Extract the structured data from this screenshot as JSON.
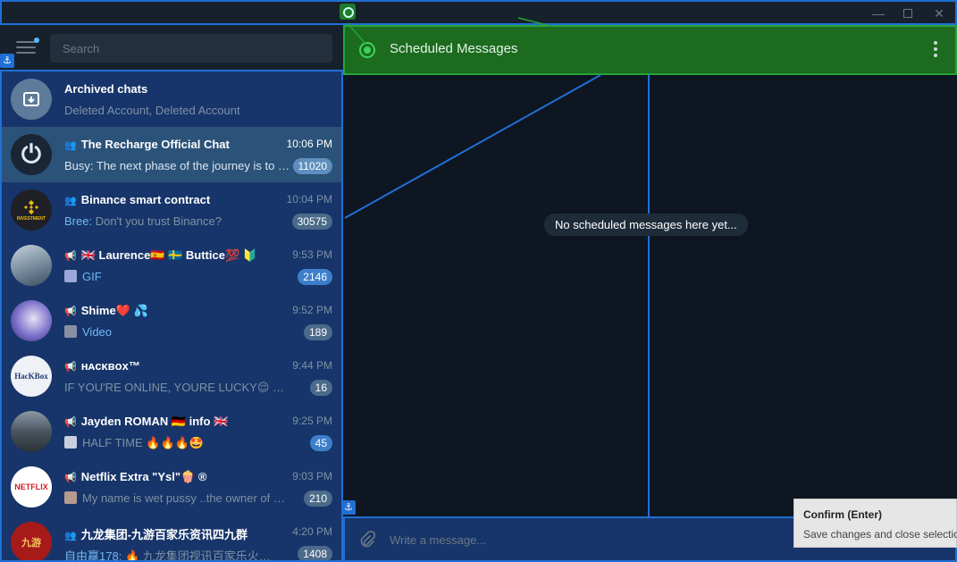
{
  "window": {
    "minimize": "—",
    "close": "✕"
  },
  "search": {
    "placeholder": "Search"
  },
  "chats": [
    {
      "name": "Archived chats",
      "preview": "Deleted Account, Deleted Account",
      "time": "",
      "badge": "",
      "active": false
    },
    {
      "name": "The Recharge Official Chat",
      "kind": "group",
      "preview": "Busy: The next phase of the journey is to …",
      "time": "10:06 PM",
      "badge": "11020",
      "active": true
    },
    {
      "name": "Binance smart contract",
      "kind": "group",
      "sender": "Bree:",
      "preview": "Don't you trust Binance?",
      "time": "10:04 PM",
      "badge": "30575"
    },
    {
      "name": "🇬🇧 Laurence🇪🇸 🇸🇪 Buttice💯 🔰",
      "kind": "channel",
      "preview": "GIF",
      "time": "9:53 PM",
      "badge": "2146"
    },
    {
      "name": "Shime❤️ 💦",
      "kind": "channel",
      "preview": "Video",
      "time": "9:52 PM",
      "badge": "189"
    },
    {
      "name": "ʜᴀᴄᴋʙᴏx™",
      "kind": "channel",
      "preview": "IF YOU'RE ONLINE, YOURE LUCKY😌 Deletin…",
      "time": "9:44 PM",
      "badge": "16"
    },
    {
      "name": "Jayden ROMAN 🇩🇪 info 🇬🇧",
      "kind": "channel",
      "preview": "HALF TIME 🔥🔥🔥🤩",
      "time": "9:25 PM",
      "badge": "45"
    },
    {
      "name": "Netflix Extra \"Ysl\"🍿 ®",
      "kind": "channel",
      "preview": "My name is wet pussy ..the owner of thi…",
      "time": "9:03 PM",
      "badge": "210"
    },
    {
      "name": "九龙集团-九游百家乐资讯四九群",
      "kind": "group",
      "sender": "自由赢178:",
      "preview": "🔥 九龙集团视讯百家乐火…",
      "time": "4:20 PM",
      "badge": "1408"
    }
  ],
  "avatars": {
    "recharge": "⏻",
    "binance": "INVESTMENT",
    "hackbox": "HacKBox",
    "netflix": "NETFLIX",
    "jiulong": "九游"
  },
  "header": {
    "title": "Scheduled Messages"
  },
  "main": {
    "empty_note": "No scheduled messages here yet..."
  },
  "composer": {
    "placeholder": "Write a message..."
  },
  "tooltip": {
    "title": "Confirm (Enter)",
    "text": "Save changes and close selection"
  },
  "colors": {
    "accent": "#1f6fd6",
    "header_green": "#1c6b1f",
    "active_chat": "#2b5278"
  }
}
